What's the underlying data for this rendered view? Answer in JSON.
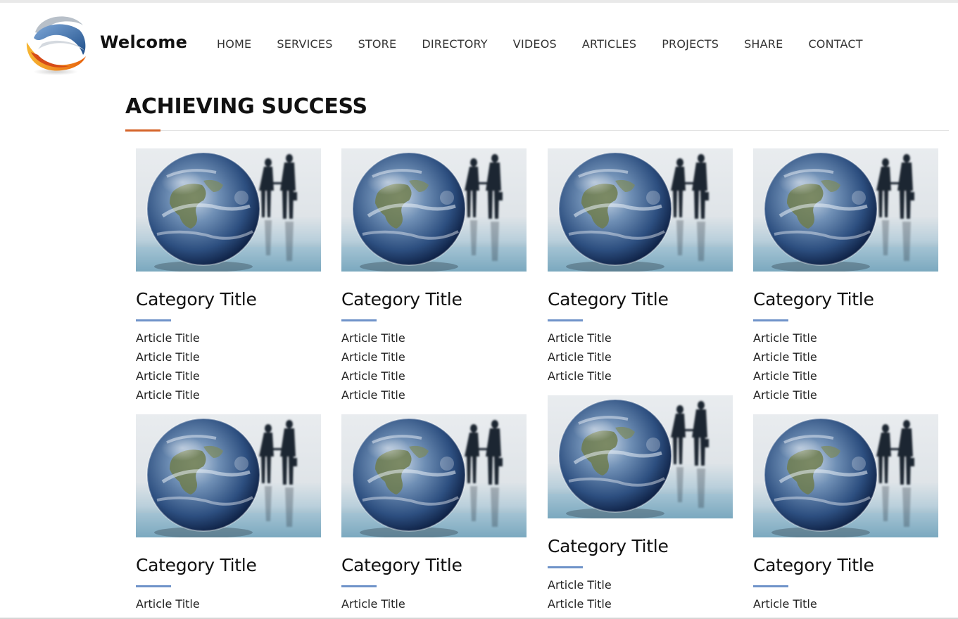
{
  "header": {
    "brand": "Welcome",
    "logo_icon": "globe-swirl-logo-icon",
    "nav": [
      {
        "label": "HOME"
      },
      {
        "label": "SERVICES"
      },
      {
        "label": "STORE"
      },
      {
        "label": "DIRECTORY"
      },
      {
        "label": "VIDEOS"
      },
      {
        "label": "ARTICLES"
      },
      {
        "label": "PROJECTS"
      },
      {
        "label": "SHARE"
      },
      {
        "label": "CONTACT"
      }
    ]
  },
  "section": {
    "title": "ACHIEVING SUCCESS",
    "accent_color": "#d5642a"
  },
  "category_accent_color": "#6f93c9",
  "thumbnail_icon": "globe-handshake-image",
  "cards": [
    {
      "title": "Category Title",
      "articles": [
        "Article Title",
        "Article Title",
        "Article Title",
        "Article Title"
      ]
    },
    {
      "title": "Category Title",
      "articles": [
        "Article Title",
        "Article Title",
        "Article Title",
        "Article Title"
      ]
    },
    {
      "title": "Category Title",
      "articles": [
        "Article Title",
        "Article Title",
        "Article Title"
      ]
    },
    {
      "title": "Category Title",
      "articles": [
        "Article Title",
        "Article Title",
        "Article Title",
        "Article Title"
      ]
    },
    {
      "title": "Category Title",
      "articles": [
        "Article Title"
      ]
    },
    {
      "title": "Category Title",
      "articles": [
        "Article Title"
      ]
    },
    {
      "title": "Category Title",
      "articles": [
        "Article Title",
        "Article Title"
      ]
    },
    {
      "title": "Category Title",
      "articles": [
        "Article Title"
      ]
    }
  ]
}
